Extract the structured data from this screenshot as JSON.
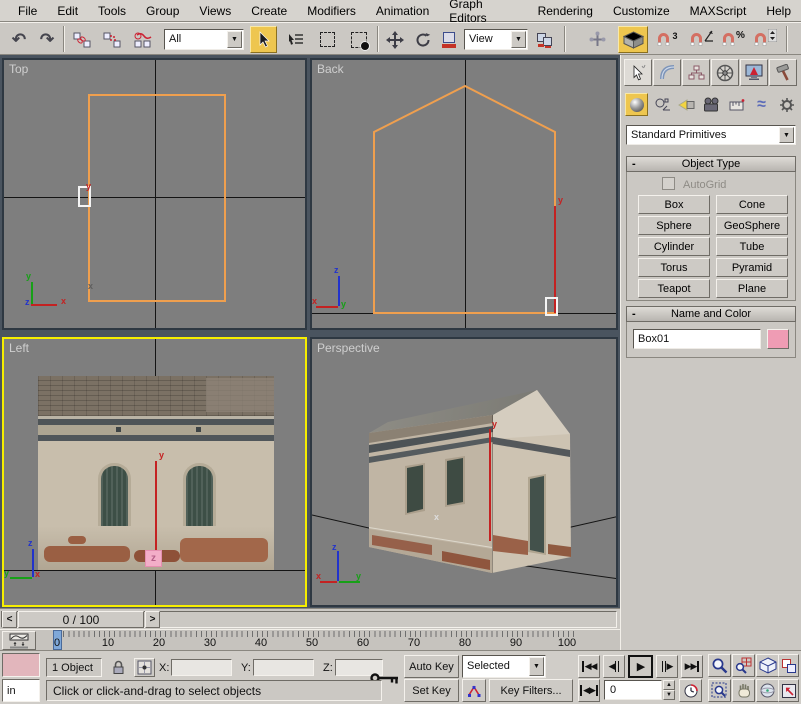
{
  "menu": {
    "items": [
      "File",
      "Edit",
      "Tools",
      "Group",
      "Views",
      "Create",
      "Modifiers",
      "Animation",
      "Graph Editors",
      "Rendering",
      "Customize",
      "MAXScript",
      "Help"
    ]
  },
  "icons": {
    "undo": "↶",
    "redo": "↷",
    "dropdown": "▼",
    "up": "▲",
    "down": "▼",
    "left": "◀",
    "right": "▶",
    "left2": "◀◀",
    "right2": "▶▶",
    "leftright": "◀▶",
    "space_warps": "≈",
    "systems": "*"
  },
  "toolbar": {
    "selection_filter_value": "All",
    "coordinate_system_value": "View",
    "snap_3d_label": "3",
    "percent_label": "%"
  },
  "viewports": {
    "top_label": "Top",
    "back_label": "Back",
    "left_label": "Left",
    "perspective_label": "Perspective",
    "axis": {
      "x": "x",
      "y": "y",
      "z": "z"
    }
  },
  "colors": {
    "wireframe": "#ef9f4e",
    "active_viewport_border": "#f6ee00",
    "highlight": "#eec64f",
    "object_color": "#ef9cb4"
  },
  "timeline": {
    "time_slider_value": "0 / 100",
    "prev_arrow": "<",
    "next_arrow": ">",
    "ticks": [
      "0",
      "10",
      "20",
      "30",
      "40",
      "50",
      "60",
      "70",
      "80",
      "90",
      "100"
    ]
  },
  "status_bar": {
    "selection_count": "1 Object",
    "x_label": "X:",
    "y_label": "Y:",
    "z_label": "Z:",
    "x_value": "",
    "y_value": "",
    "z_value": "",
    "prompt": "Click or click-and-drag to select objects",
    "mini_listener_text": "in"
  },
  "animation_controls": {
    "auto_key_label": "Auto Key",
    "set_key_label": "Set Key",
    "key_filter_scope": "Selected",
    "key_filters_label": "Key Filters...",
    "current_frame": "0"
  },
  "command_panel": {
    "category_value": "Standard Primitives",
    "object_type": {
      "title": "Object Type",
      "collapse": "-",
      "autogrid_label": "AutoGrid",
      "buttons": [
        "Box",
        "Cone",
        "Sphere",
        "GeoSphere",
        "Cylinder",
        "Tube",
        "Torus",
        "Pyramid",
        "Teapot",
        "Plane"
      ]
    },
    "name_and_color": {
      "title": "Name and Color",
      "collapse": "-",
      "object_name": "Box01",
      "object_color": "#ef9cb4"
    }
  }
}
